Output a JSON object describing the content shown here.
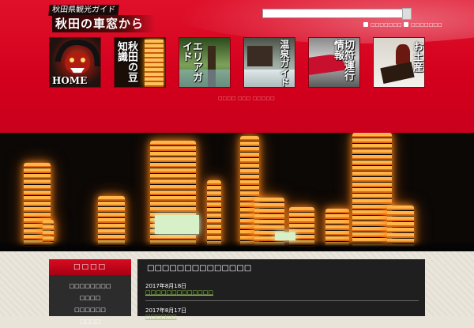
{
  "header": {
    "logo_top": "秋田県観光ガイド",
    "logo_main": "秋田の車窓から",
    "search_placeholder": "",
    "util_links": [
      "□□□□□□□",
      "□□□□□□□"
    ],
    "footnote": "□□□□ □□□ □□□□□"
  },
  "nav": [
    {
      "label": "HOME"
    },
    {
      "label": "秋田の豆知識"
    },
    {
      "label": "エリアガイド"
    },
    {
      "label": "温泉ガイド"
    },
    {
      "label": "切符運行情報"
    },
    {
      "label": "お土産"
    }
  ],
  "sidebar": {
    "title": "□□□□",
    "items": [
      "□□□□□□□□",
      "□□□□",
      "□□□□□□",
      "□□□□"
    ]
  },
  "main": {
    "title": "□□□□□□□□□□□□□□",
    "posts": [
      {
        "date": "2017年8月18日",
        "link": "□□□□□□□□□□□□□"
      },
      {
        "date": "2017年8月17日",
        "link": "□□□□□□"
      }
    ]
  },
  "colors": {
    "brand_red": "#d3001d",
    "link_green": "#9fdc4a",
    "panel_dark": "#1f1f1f"
  }
}
